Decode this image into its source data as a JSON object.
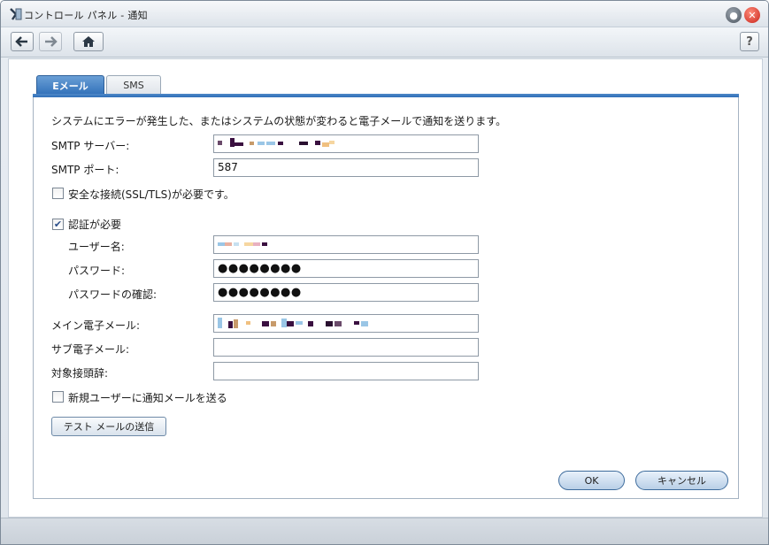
{
  "window": {
    "title": "コントロール パネル - 通知"
  },
  "toolbar": {
    "help_label": "?"
  },
  "tabs": [
    {
      "label": "Eメール",
      "active": true
    },
    {
      "label": "SMS",
      "active": false
    }
  ],
  "form": {
    "description": "システムにエラーが発生した、またはシステムの状態が変わると電子メールで通知を送ります。",
    "smtp_server_label": "SMTP サーバー:",
    "smtp_server_value": "",
    "smtp_port_label": "SMTP ポート:",
    "smtp_port_value": "587",
    "ssl_label": "安全な接続(SSL/TLS)が必要です。",
    "ssl_checked": false,
    "auth_label": "認証が必要",
    "auth_checked": true,
    "username_label": "ユーザー名:",
    "password_label": "パスワード:",
    "password_value": "●●●●●●●●",
    "password_confirm_label": "パスワードの確認:",
    "password_confirm_value": "●●●●●●●●",
    "main_email_label": "メイン電子メール:",
    "sub_email_label": "サブ電子メール:",
    "sub_email_value": "",
    "subject_prefix_label": "対象接頭辞:",
    "subject_prefix_value": "",
    "new_user_notify_label": "新規ユーザーに通知メールを送る",
    "new_user_notify_checked": false,
    "test_mail_button": "テスト メールの送信"
  },
  "buttons": {
    "ok": "OK",
    "cancel": "キャンセル"
  },
  "colors": {
    "active_tab": "#2f6fb8",
    "checkmark": "#2a4e8a"
  }
}
